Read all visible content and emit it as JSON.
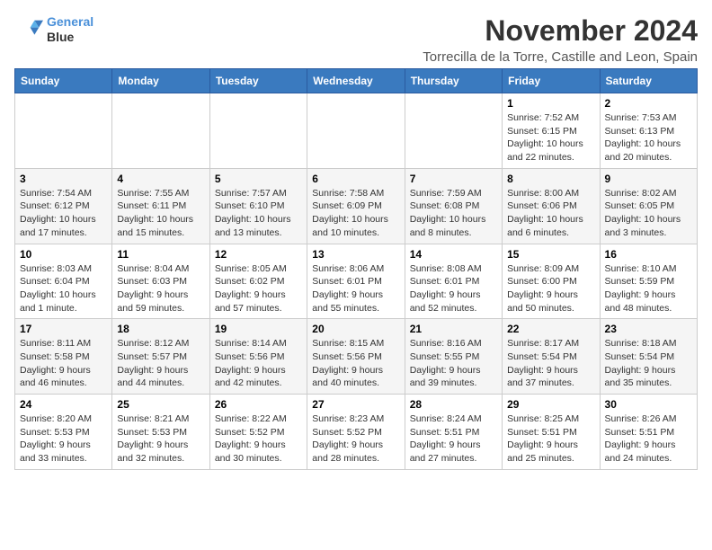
{
  "header": {
    "logo_line1": "General",
    "logo_line2": "Blue",
    "month_title": "November 2024",
    "location": "Torrecilla de la Torre, Castille and Leon, Spain"
  },
  "weekdays": [
    "Sunday",
    "Monday",
    "Tuesday",
    "Wednesday",
    "Thursday",
    "Friday",
    "Saturday"
  ],
  "weeks": [
    [
      {
        "day": "",
        "info": ""
      },
      {
        "day": "",
        "info": ""
      },
      {
        "day": "",
        "info": ""
      },
      {
        "day": "",
        "info": ""
      },
      {
        "day": "",
        "info": ""
      },
      {
        "day": "1",
        "info": "Sunrise: 7:52 AM\nSunset: 6:15 PM\nDaylight: 10 hours and 22 minutes."
      },
      {
        "day": "2",
        "info": "Sunrise: 7:53 AM\nSunset: 6:13 PM\nDaylight: 10 hours and 20 minutes."
      }
    ],
    [
      {
        "day": "3",
        "info": "Sunrise: 7:54 AM\nSunset: 6:12 PM\nDaylight: 10 hours and 17 minutes."
      },
      {
        "day": "4",
        "info": "Sunrise: 7:55 AM\nSunset: 6:11 PM\nDaylight: 10 hours and 15 minutes."
      },
      {
        "day": "5",
        "info": "Sunrise: 7:57 AM\nSunset: 6:10 PM\nDaylight: 10 hours and 13 minutes."
      },
      {
        "day": "6",
        "info": "Sunrise: 7:58 AM\nSunset: 6:09 PM\nDaylight: 10 hours and 10 minutes."
      },
      {
        "day": "7",
        "info": "Sunrise: 7:59 AM\nSunset: 6:08 PM\nDaylight: 10 hours and 8 minutes."
      },
      {
        "day": "8",
        "info": "Sunrise: 8:00 AM\nSunset: 6:06 PM\nDaylight: 10 hours and 6 minutes."
      },
      {
        "day": "9",
        "info": "Sunrise: 8:02 AM\nSunset: 6:05 PM\nDaylight: 10 hours and 3 minutes."
      }
    ],
    [
      {
        "day": "10",
        "info": "Sunrise: 8:03 AM\nSunset: 6:04 PM\nDaylight: 10 hours and 1 minute."
      },
      {
        "day": "11",
        "info": "Sunrise: 8:04 AM\nSunset: 6:03 PM\nDaylight: 9 hours and 59 minutes."
      },
      {
        "day": "12",
        "info": "Sunrise: 8:05 AM\nSunset: 6:02 PM\nDaylight: 9 hours and 57 minutes."
      },
      {
        "day": "13",
        "info": "Sunrise: 8:06 AM\nSunset: 6:01 PM\nDaylight: 9 hours and 55 minutes."
      },
      {
        "day": "14",
        "info": "Sunrise: 8:08 AM\nSunset: 6:01 PM\nDaylight: 9 hours and 52 minutes."
      },
      {
        "day": "15",
        "info": "Sunrise: 8:09 AM\nSunset: 6:00 PM\nDaylight: 9 hours and 50 minutes."
      },
      {
        "day": "16",
        "info": "Sunrise: 8:10 AM\nSunset: 5:59 PM\nDaylight: 9 hours and 48 minutes."
      }
    ],
    [
      {
        "day": "17",
        "info": "Sunrise: 8:11 AM\nSunset: 5:58 PM\nDaylight: 9 hours and 46 minutes."
      },
      {
        "day": "18",
        "info": "Sunrise: 8:12 AM\nSunset: 5:57 PM\nDaylight: 9 hours and 44 minutes."
      },
      {
        "day": "19",
        "info": "Sunrise: 8:14 AM\nSunset: 5:56 PM\nDaylight: 9 hours and 42 minutes."
      },
      {
        "day": "20",
        "info": "Sunrise: 8:15 AM\nSunset: 5:56 PM\nDaylight: 9 hours and 40 minutes."
      },
      {
        "day": "21",
        "info": "Sunrise: 8:16 AM\nSunset: 5:55 PM\nDaylight: 9 hours and 39 minutes."
      },
      {
        "day": "22",
        "info": "Sunrise: 8:17 AM\nSunset: 5:54 PM\nDaylight: 9 hours and 37 minutes."
      },
      {
        "day": "23",
        "info": "Sunrise: 8:18 AM\nSunset: 5:54 PM\nDaylight: 9 hours and 35 minutes."
      }
    ],
    [
      {
        "day": "24",
        "info": "Sunrise: 8:20 AM\nSunset: 5:53 PM\nDaylight: 9 hours and 33 minutes."
      },
      {
        "day": "25",
        "info": "Sunrise: 8:21 AM\nSunset: 5:53 PM\nDaylight: 9 hours and 32 minutes."
      },
      {
        "day": "26",
        "info": "Sunrise: 8:22 AM\nSunset: 5:52 PM\nDaylight: 9 hours and 30 minutes."
      },
      {
        "day": "27",
        "info": "Sunrise: 8:23 AM\nSunset: 5:52 PM\nDaylight: 9 hours and 28 minutes."
      },
      {
        "day": "28",
        "info": "Sunrise: 8:24 AM\nSunset: 5:51 PM\nDaylight: 9 hours and 27 minutes."
      },
      {
        "day": "29",
        "info": "Sunrise: 8:25 AM\nSunset: 5:51 PM\nDaylight: 9 hours and 25 minutes."
      },
      {
        "day": "30",
        "info": "Sunrise: 8:26 AM\nSunset: 5:51 PM\nDaylight: 9 hours and 24 minutes."
      }
    ]
  ]
}
